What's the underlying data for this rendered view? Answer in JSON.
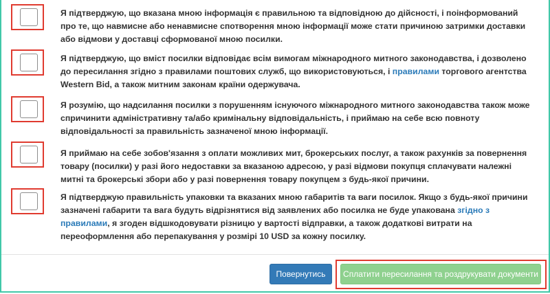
{
  "items": [
    {
      "checked": false,
      "parts": [
        {
          "text": "Я підтверджую, що вказана мною інформація є правильною та відповідною до дійсності, і поінформований про те, що навмисне або ненавмисне спотворення мною інформації може стати причиною затримки доставки або відмови у доставці сформованої мною посилки."
        }
      ]
    },
    {
      "checked": false,
      "parts": [
        {
          "text": "Я підтверджую, що вміст посилки відповідає всім вимогам міжнародного митного законодавства, і дозволено до пересилання згідно з правилами поштових служб, що використовуються, і "
        },
        {
          "text": "правилами",
          "link": true
        },
        {
          "text": " торгового агентства Western Bid, а також митним законам країни одержувача."
        }
      ]
    },
    {
      "checked": false,
      "parts": [
        {
          "text": "Я розумію, що надсилання посилки з порушенням існуючого міжнародного митного законодавства також може спричинити адміністративну та/або кримінальну відповідальність, і приймаю на себе всю повноту відповідальності за правильність зазначеної мною інформації."
        }
      ]
    },
    {
      "checked": false,
      "parts": [
        {
          "text": "Я приймаю на себе зобов'язання з оплати можливих мит, брокерських послуг, а також рахунків за повернення товару (посилки) у разі його недоставки за вказаною адресою, у разі відмови покупця сплачувати належні митні та брокерські збори або у разі повернення товару покупцем з будь-якої причини."
        }
      ]
    },
    {
      "checked": false,
      "parts": [
        {
          "text": "Я підтверджую правильність упаковки та вказаних мною габаритів та ваги посилок. Якщо з будь-якої причини зазначені габарити та вага будуть відрізнятися від заявлених або посилка не буде упакована "
        },
        {
          "text": "згідно з правилами",
          "link": true
        },
        {
          "text": ", я згоден відшкодовувати різницю у вартості відправки, а також додаткові витрати на переоформлення або перепакування у розмірі 10 USD за кожну посилку."
        }
      ]
    }
  ],
  "buttons": {
    "back_label": "Повернутись",
    "pay_label": "Сплатити пересилання та роздрукувати документи"
  },
  "colors": {
    "accent_border": "#41c8a8",
    "highlight": "#e03a2f",
    "primary": "#337ab7",
    "success_disabled": "#8fd18f",
    "link": "#2a7ab8"
  }
}
